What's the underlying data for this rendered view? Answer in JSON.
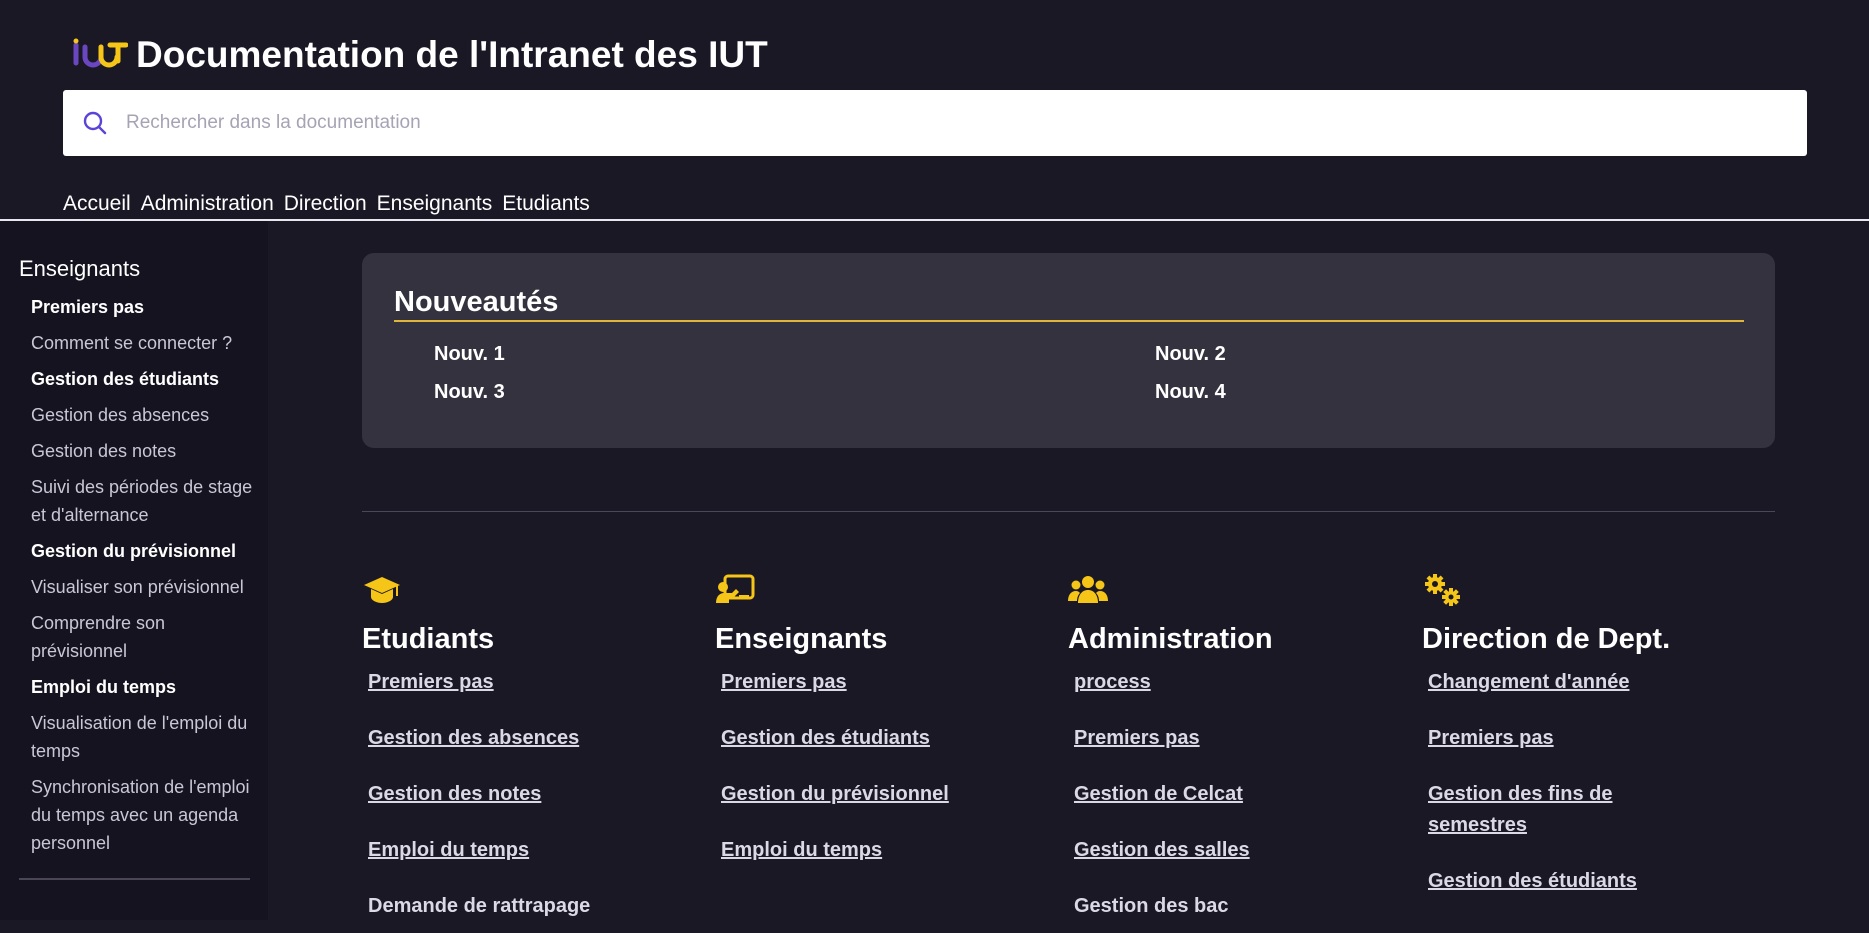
{
  "header": {
    "title": "Documentation de l'Intranet des IUT",
    "logo_text": "IUT",
    "search_placeholder": "Rechercher dans la documentation",
    "nav": [
      "Accueil",
      "Administration",
      "Direction",
      "Enseignants",
      "Etudiants"
    ]
  },
  "sidebar": {
    "title": "Enseignants",
    "items": [
      {
        "label": "Premiers pas",
        "type": "section"
      },
      {
        "label": "Comment se connecter ?",
        "type": "link"
      },
      {
        "label": "Gestion des étudiants",
        "type": "section"
      },
      {
        "label": "Gestion des absences",
        "type": "link"
      },
      {
        "label": "Gestion des notes",
        "type": "link"
      },
      {
        "label": "Suivi des périodes de stage et d'alternance",
        "type": "link"
      },
      {
        "label": "Gestion du prévisionnel",
        "type": "section"
      },
      {
        "label": "Visualiser son prévisionnel",
        "type": "link"
      },
      {
        "label": "Comprendre son prévisionnel",
        "type": "link"
      },
      {
        "label": "Emploi du temps",
        "type": "section"
      },
      {
        "label": "Visualisation de l'emploi du temps",
        "type": "link"
      },
      {
        "label": "Synchronisation de l'emploi du temps avec un agenda personnel",
        "type": "link"
      }
    ]
  },
  "news": {
    "title": "Nouveautés",
    "items": [
      "Nouv. 1",
      "Nouv. 2",
      "Nouv. 3",
      "Nouv. 4"
    ]
  },
  "columns": [
    {
      "icon": "graduation-cap-icon",
      "title": "Etudiants",
      "links": [
        "Premiers pas",
        "Gestion des absences",
        "Gestion des notes",
        "Emploi du temps",
        "Demande de rattrapage"
      ]
    },
    {
      "icon": "teacher-board-icon",
      "title": "Enseignants",
      "links": [
        "Premiers pas",
        "Gestion des étudiants",
        "Gestion du prévisionnel",
        "Emploi du temps"
      ]
    },
    {
      "icon": "users-group-icon",
      "title": "Administration",
      "links": [
        "process",
        "Premiers pas",
        "Gestion de Celcat",
        "Gestion des salles",
        "Gestion des bac"
      ]
    },
    {
      "icon": "gears-icon",
      "title": "Direction de Dept.",
      "links": [
        "Changement d'année",
        "Premiers pas",
        "Gestion des fins de semestres",
        "Gestion des étudiants"
      ]
    }
  ],
  "colors": {
    "background": "#1b1825",
    "sidebar": "#151320",
    "card": "#35323f",
    "accent_yellow": "#f5c518",
    "underline": "#e0b53a",
    "logo_purple": "#6b46c1"
  }
}
